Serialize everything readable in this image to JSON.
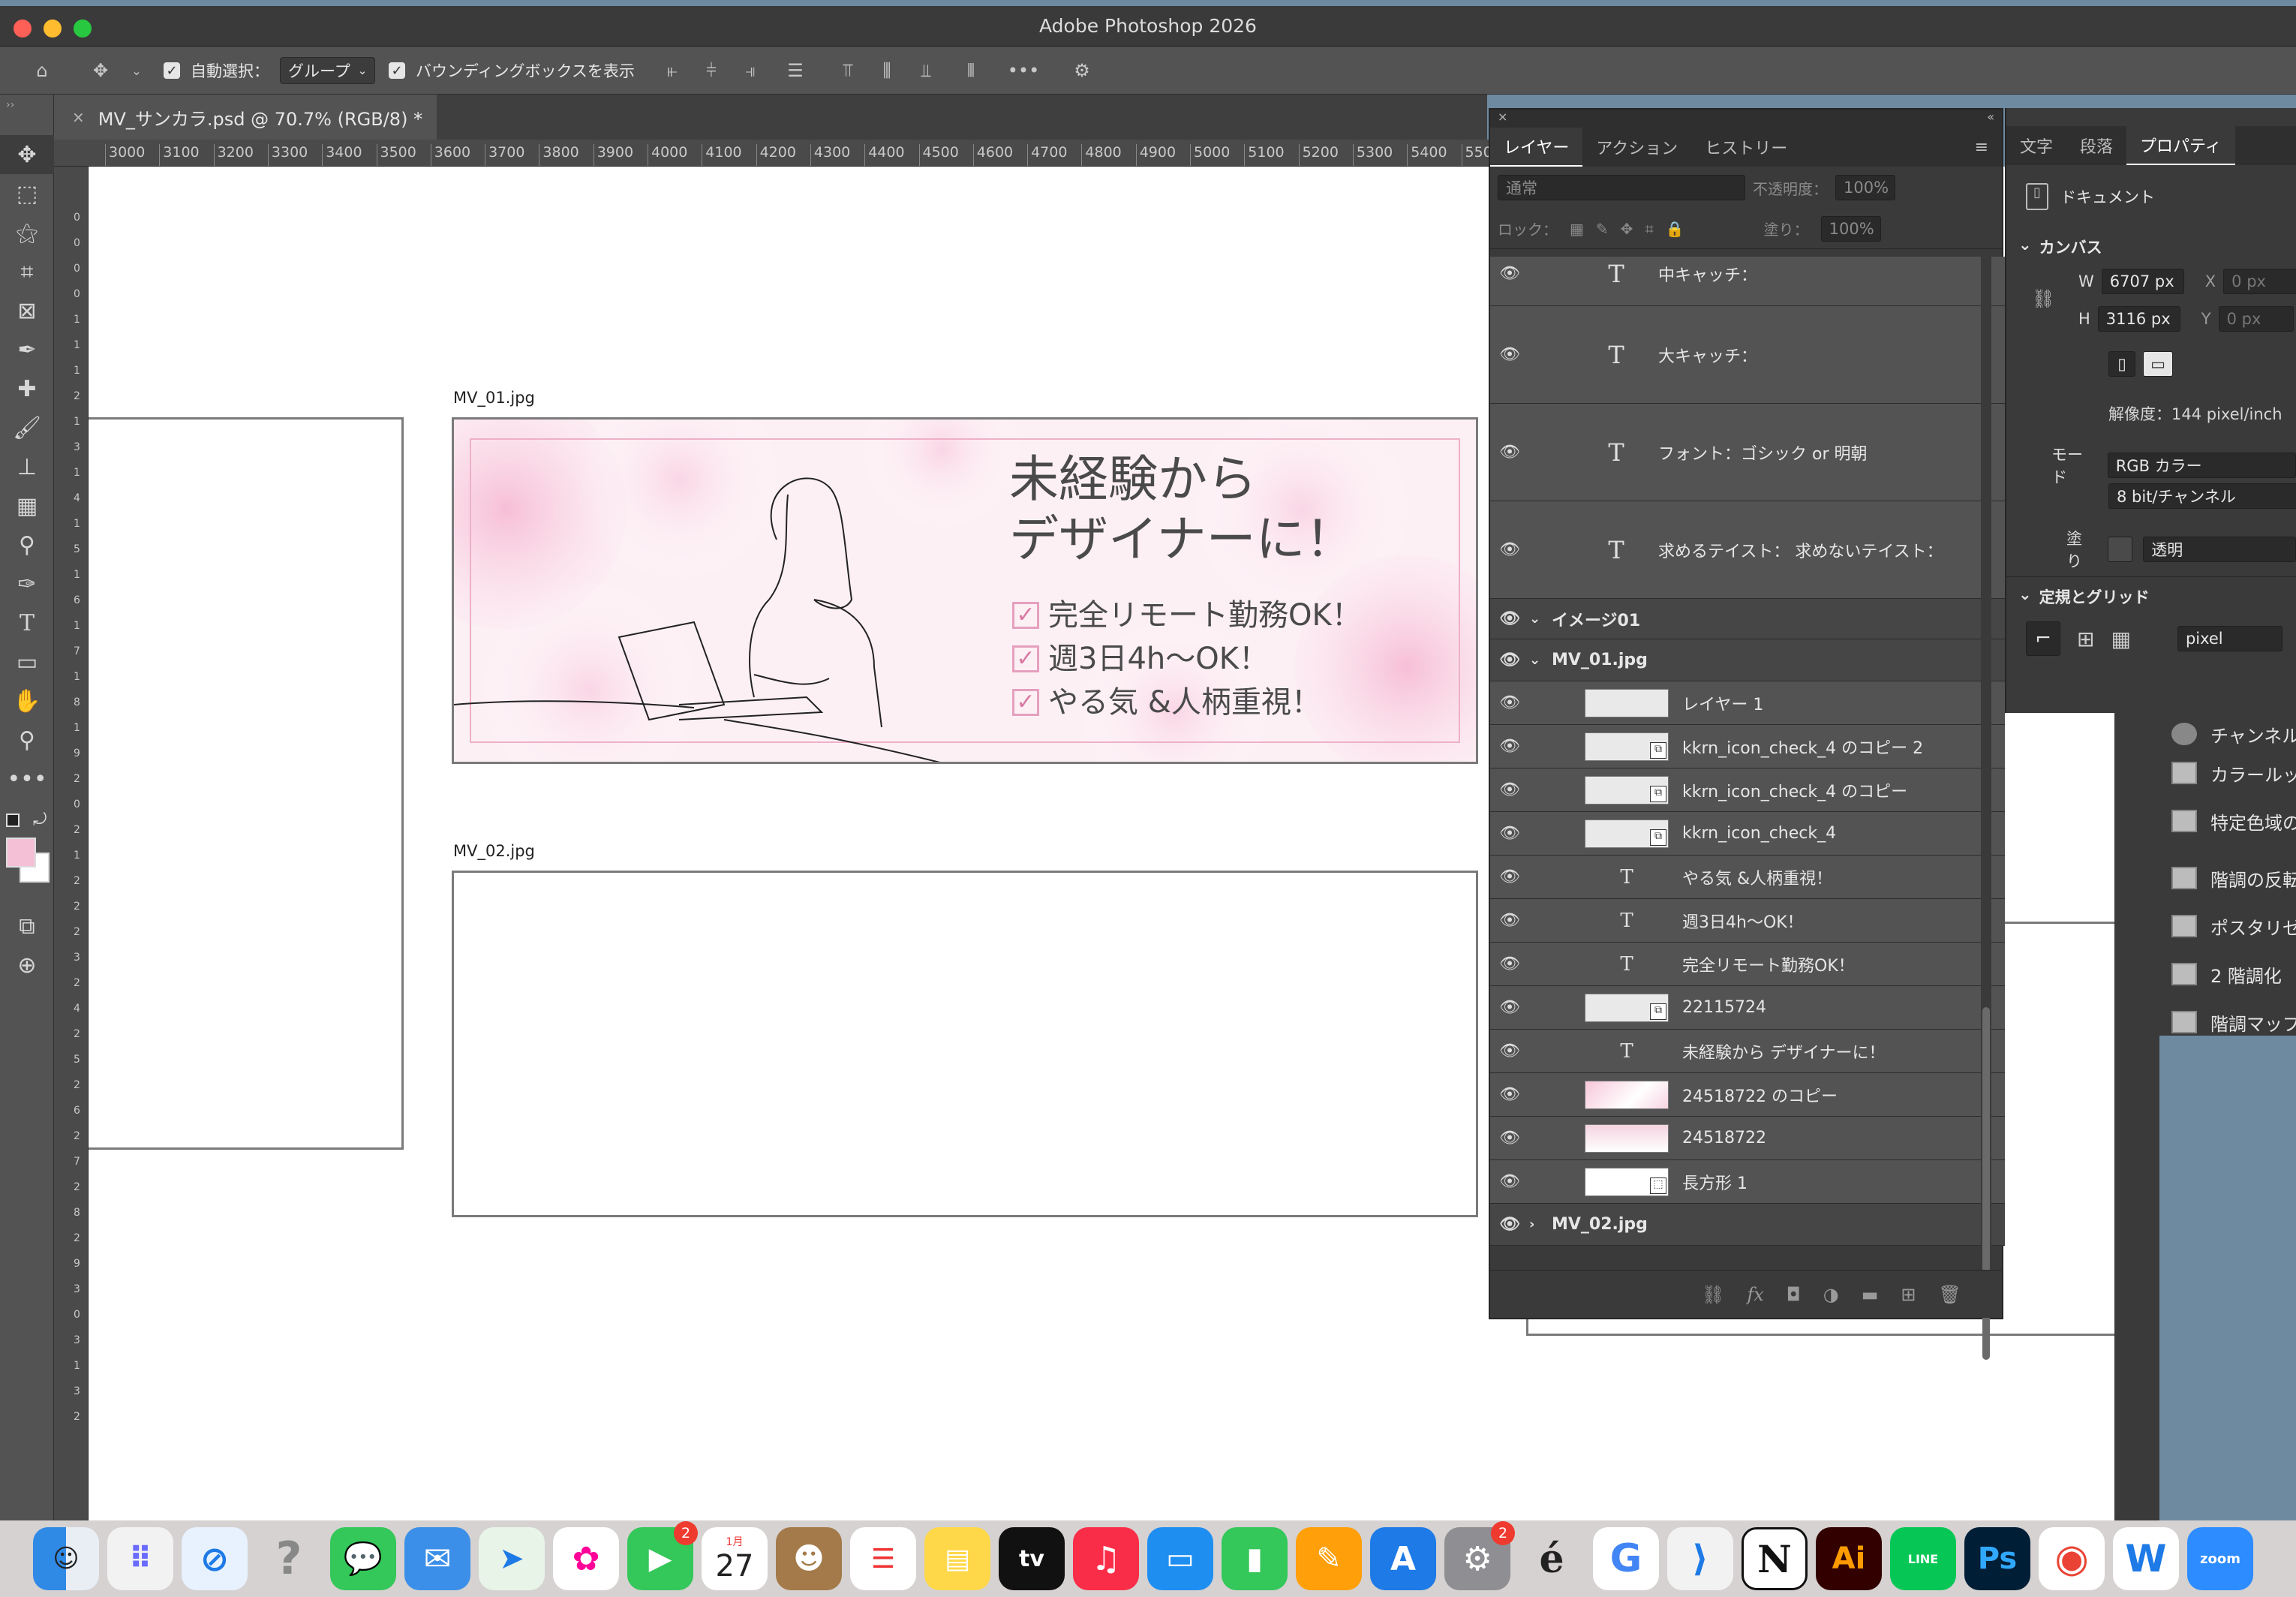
{
  "window": {
    "title": "Adobe Photoshop 2026"
  },
  "options_bar": {
    "auto_select_label": "自動選択：",
    "auto_select_value": "グループ",
    "bounding_box_label": "バウンディングボックスを表示"
  },
  "document": {
    "tab_title": "MV_サンカラ.psd @ 70.7% (RGB/8) *"
  },
  "ruler": {
    "h_ticks": [
      "3000",
      "3100",
      "3200",
      "3300",
      "3400",
      "3500",
      "3600",
      "3700",
      "3800",
      "3900",
      "4000",
      "4100",
      "4200",
      "4300",
      "4400",
      "4500",
      "4600",
      "4700",
      "4800",
      "4900",
      "5000",
      "5100",
      "5200",
      "5300",
      "5400",
      "5500"
    ],
    "v_ticks": [
      "0",
      "0",
      "0",
      "0",
      "1",
      "1",
      "1",
      "2",
      "1",
      "3",
      "1",
      "4",
      "1",
      "5",
      "1",
      "6",
      "1",
      "7",
      "1",
      "8",
      "1",
      "9",
      "2",
      "0",
      "2",
      "1",
      "2",
      "2",
      "2",
      "3",
      "2",
      "4",
      "2",
      "5",
      "2",
      "6",
      "2",
      "7",
      "2",
      "8",
      "2",
      "9",
      "3",
      "0",
      "3",
      "1",
      "3",
      "2"
    ]
  },
  "artboards": {
    "mv01_label": "MV_01.jpg",
    "mv02_label": "MV_02.jpg"
  },
  "banner": {
    "heading_line1": "未経験から",
    "heading_line2": "デザイナーに！",
    "checks": [
      "完全リモート勤務OK！",
      "週3日4h〜OK！",
      "やる気 &人柄重視！"
    ]
  },
  "layers_panel": {
    "tabs": [
      "レイヤー",
      "アクション",
      "ヒストリー"
    ],
    "blend_mode": "通常",
    "opacity_label": "不透明度：",
    "opacity_value": "100%",
    "lock_label": "ロック：",
    "fill_label": "塗り：",
    "fill_value": "100%",
    "text_layers_top": [
      "中キャッチ：",
      "大キャッチ：",
      "フォント：ゴシック or 明朝",
      "求めるテイスト：  求めないテイスト："
    ],
    "group_image01": "イメージ01",
    "group_mv01": "MV_01.jpg",
    "layers": [
      "レイヤー 1",
      "kkrn_icon_check_4 のコピー 2",
      "kkrn_icon_check_4 のコピー",
      "kkrn_icon_check_4",
      "やる気 &人柄重視！",
      "週3日4h〜OK！",
      "完全リモート勤務OK！",
      "22115724",
      "未経験から デザイナーに！",
      "24518722 のコピー",
      "24518722",
      "長方形 1"
    ],
    "group_mv02": "MV_02.jpg",
    "footer_fx": "fx"
  },
  "properties_panel": {
    "tabs": [
      "文字",
      "段落",
      "プロパティ"
    ],
    "doc_label": "ドキュメント",
    "canvas_section": "カンバス",
    "w_label": "W",
    "w_value": "6707 px",
    "h_label": "H",
    "h_value": "3116 px",
    "x_label": "X",
    "x_value": "0 px",
    "y_label": "Y",
    "y_value": "0 px",
    "resolution": "解像度：144 pixel/inch",
    "mode_label": "モード",
    "mode_value": "RGB カラー",
    "bit_value": "8 bit/チャンネル",
    "fill_label": "塗り",
    "fill_value": "透明",
    "rulers_section": "定規とグリッド",
    "unit_value": "pixel"
  },
  "adjustments": [
    "チャンネル",
    "カラールッ",
    "特定色域の",
    "階調の反転",
    "ポスタリゼ",
    "2 階調化",
    "階調マップ"
  ],
  "dock": {
    "calendar_month": "1月",
    "calendar_day": "27",
    "facetime_badge": "2",
    "settings_badge": "2",
    "ai_label": "Ai",
    "ps_label": "Ps",
    "line_label": "LINE",
    "zoom_label": "zoom",
    "appletv_label": "tv"
  },
  "colors": {
    "accent_pink": "#e8a3c1",
    "panel_bg": "#3a3a3a",
    "canvas_bg": "#ffffff"
  }
}
